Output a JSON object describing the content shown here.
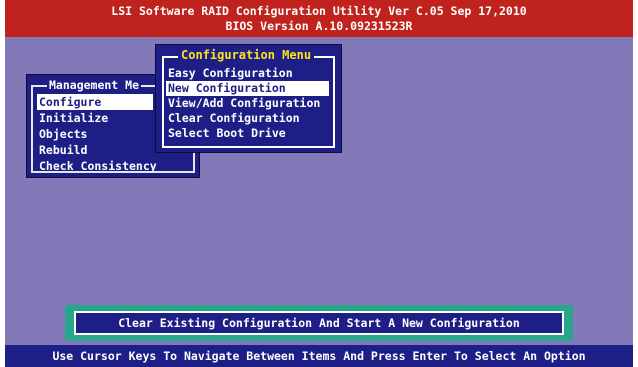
{
  "title_bar": {
    "line1": "LSI Software RAID Configuration Utility Ver C.05 Sep 17,2010",
    "line2": "BIOS Version  A.10.09231523R"
  },
  "management_menu": {
    "title": "Management Me",
    "items": [
      {
        "label": "Configure",
        "selected": true
      },
      {
        "label": "Initialize",
        "selected": false
      },
      {
        "label": "Objects",
        "selected": false
      },
      {
        "label": "Rebuild",
        "selected": false
      },
      {
        "label": "Check Consistency",
        "selected": false
      }
    ]
  },
  "configuration_menu": {
    "title": "Configuration Menu",
    "items": [
      {
        "label": "Easy Configuration",
        "selected": false
      },
      {
        "label": "New Configuration",
        "selected": true
      },
      {
        "label": "View/Add Configuration",
        "selected": false
      },
      {
        "label": "Clear Configuration",
        "selected": false
      },
      {
        "label": "Select Boot Drive",
        "selected": false
      }
    ]
  },
  "status_message": "Clear Existing Configuration And Start A New Configuration",
  "help_text": "Use Cursor Keys To Navigate Between Items And Press Enter To Select An Option",
  "colors": {
    "screen_background": "#8479b8",
    "title_bar": "#c0231e",
    "menu_background": "#1d1f86",
    "menu_title": "#ffe21a",
    "status_frame": "#28a68c"
  }
}
